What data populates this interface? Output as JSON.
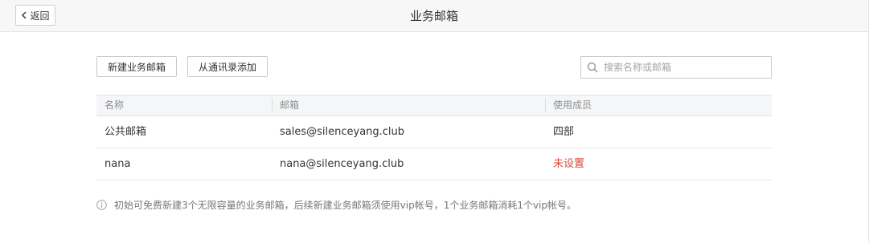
{
  "header": {
    "back_label": "返回",
    "title": "业务邮箱"
  },
  "toolbar": {
    "new_label": "新建业务邮箱",
    "contacts_label": "从通讯录添加"
  },
  "search": {
    "placeholder": "搜索名称或邮箱",
    "value": ""
  },
  "table": {
    "columns": [
      "名称",
      "邮箱",
      "使用成员"
    ],
    "rows": [
      {
        "name": "公共邮箱",
        "email": "sales@silenceyang.club",
        "members": "四部"
      },
      {
        "name": "nana",
        "email": "nana@silenceyang.club",
        "members": "未设置"
      }
    ]
  },
  "note": "初始可免费新建3个无限容量的业务邮箱，后续新建业务邮箱须使用vip帐号，1个业务邮箱消耗1个vip帐号。",
  "colors": {
    "warning": "#d94a38",
    "header_bg": "#f7f7f8"
  },
  "icons": {
    "back": "chevron-left-icon",
    "search": "search-icon",
    "info": "info-icon"
  }
}
